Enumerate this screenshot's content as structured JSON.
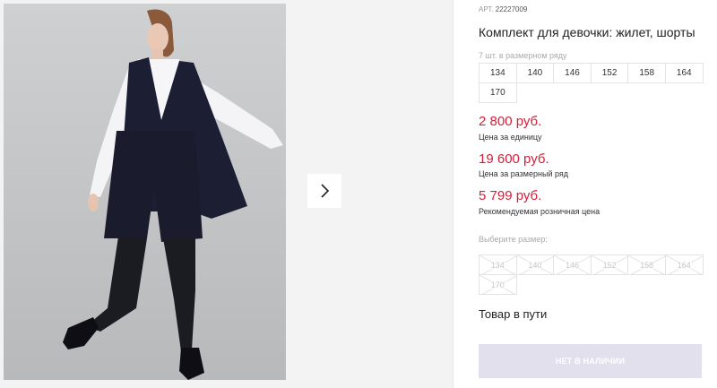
{
  "product": {
    "art_label": "АРТ.",
    "art_number": "22227009",
    "title": "Комплект для девочки: жилет, шорты"
  },
  "sizes": {
    "note": "7 шт. в размерном ряду",
    "items": [
      "134",
      "140",
      "146",
      "152",
      "158",
      "164",
      "170"
    ]
  },
  "prices": [
    {
      "value": "2 800 руб.",
      "label": "Цена за единицу"
    },
    {
      "value": "19 600 руб.",
      "label": "Цена за размерный ряд"
    },
    {
      "value": "5 799 руб.",
      "label": "Рекомендуемая розничная цена"
    }
  ],
  "choose": {
    "label": "Выберите размер:",
    "items": [
      "134",
      "140",
      "146",
      "152",
      "158",
      "164",
      "170"
    ],
    "state": "unavailable"
  },
  "availability": "Товар в пути",
  "buy_button": "НЕТ В НАЛИЧИИ",
  "colors": {
    "price": "#d4203a",
    "button_bg": "#e2e0ec",
    "gallery_bg": "#f3f3f3"
  },
  "icons": {
    "next": "chevron-right-icon"
  }
}
